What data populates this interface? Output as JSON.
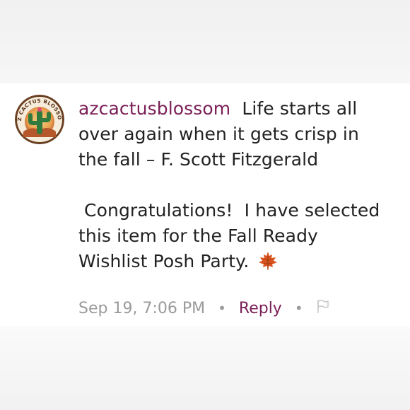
{
  "comment": {
    "username": "azcactusblossom",
    "quote_text": "Life starts all over again when it gets crisp in the fall – F. Scott Fitzgerald",
    "message_text": " Congratulations!  I have selected this item for the Fall Ready Wishlist Posh Party.",
    "emoji": "maple-leaf",
    "timestamp": "Sep 19, 7:06 PM",
    "separator": "•",
    "reply_label": "Reply",
    "flag_icon": "flag-icon"
  },
  "avatar": {
    "logo_text": "AZ CACTUS BLOSSOM"
  },
  "colors": {
    "username": "#7a1f57",
    "reply": "#7a1f57",
    "meta": "#9a9a9a",
    "text": "#222222"
  }
}
